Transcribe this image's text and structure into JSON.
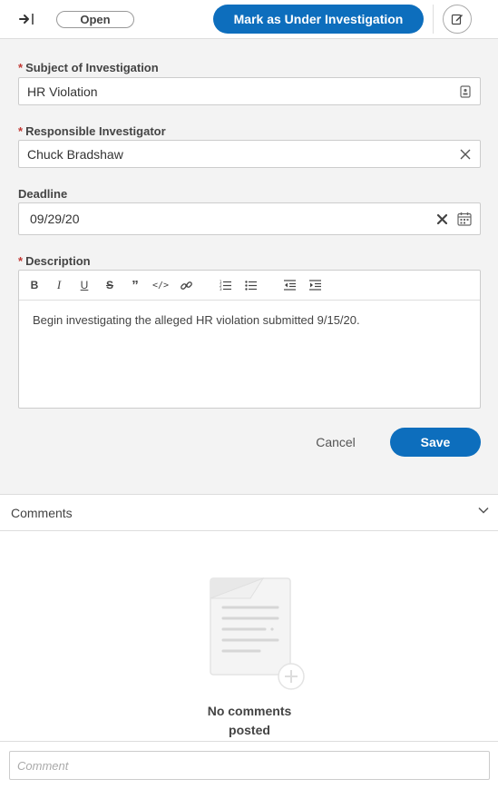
{
  "header": {
    "status": "Open",
    "primary_action": "Mark as Under Investigation",
    "collapse_icon": "collapse-right-icon",
    "edit_icon": "edit-icon"
  },
  "form": {
    "required_marker": "*",
    "subject": {
      "label": "Subject of Investigation",
      "value": "HR Violation",
      "required": true,
      "icon": "record-icon"
    },
    "investigator": {
      "label": "Responsible Investigator",
      "value": "Chuck Bradshaw",
      "required": true,
      "icon": "clear-icon"
    },
    "deadline": {
      "label": "Deadline",
      "value": "09/29/20",
      "required": false,
      "icons": [
        "clear-x-icon",
        "calendar-icon"
      ]
    },
    "description": {
      "label": "Description",
      "required": true,
      "toolbar": [
        "bold",
        "italic",
        "underline",
        "strikethrough",
        "quote",
        "code",
        "link",
        "ordered-list",
        "bullet-list",
        "outdent",
        "indent"
      ],
      "value": "Begin investigating the alleged HR violation submitted 9/15/20."
    }
  },
  "actions": {
    "cancel": "Cancel",
    "save": "Save"
  },
  "comments": {
    "title": "Comments",
    "empty_line1": "No comments",
    "empty_line2": "posted",
    "input_placeholder": "Comment"
  },
  "colors": {
    "primary": "#0d6ebd",
    "required": "#c23934"
  }
}
